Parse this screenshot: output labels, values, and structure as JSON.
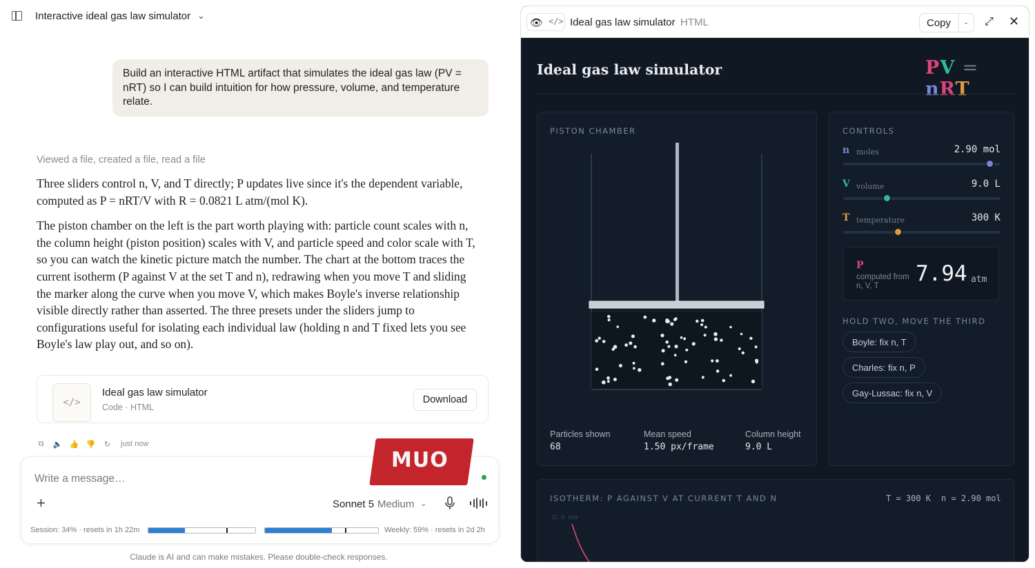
{
  "header": {
    "title": "Interactive ideal gas law simulator"
  },
  "chat": {
    "user_message": "Build an interactive HTML artifact that simulates the ideal gas law (PV = nRT) so I can build intuition for how pressure, volume, and temperature relate.",
    "tool_summary": "Viewed a file, created a file, read a file",
    "reply_p1": "Three sliders control n, V, and T directly; P updates live since it's the dependent variable, computed as P = nRT/V with R = 0.0821 L atm/(mol K).",
    "reply_p2": "The piston chamber on the left is the part worth playing with: particle count scales with n, the column height (piston position) scales with V, and particle speed and color scale with T, so you can watch the kinetic picture match the number. The chart at the bottom traces the current isotherm (P against V at the set T and n), redrawing when you move T and sliding the marker along the curve when you move V, which makes Boyle's inverse relationship visible directly rather than asserted. The three presets under the sliders jump to configurations useful for isolating each individual law (holding n and T fixed lets you see Boyle's law play out, and so on).",
    "artifact_card": {
      "name": "Ideal gas law simulator",
      "meta": "Code · HTML",
      "download_label": "Download",
      "thumb_icon": "code-icon"
    },
    "timestamp": "just now"
  },
  "composer": {
    "placeholder": "Write a message…",
    "model": "Sonnet 5",
    "mode": "Medium",
    "session_usage": "Session: 34% · resets in 1h 22m",
    "session_pct": 34,
    "weekly_usage": "Weekly: 59% · resets in 2d 2h",
    "weekly_pct": 59,
    "disclaimer": "Claude is AI and can make mistakes. Please double-check responses."
  },
  "panel": {
    "title": "Ideal gas law simulator",
    "type": "HTML",
    "copy_label": "Copy"
  },
  "sim": {
    "title": "Ideal gas law simulator",
    "formula": {
      "p": "P",
      "v": "V",
      "eq": "=",
      "n": "n",
      "r": "R",
      "t": "T"
    },
    "chamber": {
      "label": "PISTON CHAMBER",
      "particles_label": "Particles shown",
      "particles_value": "68",
      "speed_label": "Mean speed",
      "speed_value": "1.50 px/frame",
      "height_label": "Column height",
      "height_value": "9.0 L",
      "particle_count": 68
    },
    "controls": {
      "label": "CONTROLS",
      "n": {
        "symbol": "n",
        "name": "moles",
        "value": "2.90 mol",
        "level": 0.93
      },
      "v": {
        "symbol": "V",
        "name": "volume",
        "value": "9.0 L",
        "level": 0.28
      },
      "t": {
        "symbol": "T",
        "name": "temperature",
        "value": "300 K",
        "level": 0.35
      }
    },
    "pressure": {
      "symbol": "P",
      "note": "computed from n, V, T",
      "value": "7.94",
      "unit": "atm"
    },
    "presets": {
      "label": "HOLD TWO, MOVE THE THIRD",
      "items": [
        "Boyle: fix n, T",
        "Charles: fix n, P",
        "Gay-Lussac: fix n, V"
      ]
    },
    "isotherm": {
      "label": "ISOTHERM: P AGAINST V AT CURRENT T AND N",
      "t_readout": "T = 300 K",
      "n_readout": "n = 2.90 mol",
      "y_tick": "32.0 atm"
    },
    "watermark": "MUO",
    "colors": {
      "pressure": "#e0457a",
      "volume": "#2fb7a0",
      "moles": "#7a86d8",
      "temperature": "#e39a3e"
    }
  }
}
